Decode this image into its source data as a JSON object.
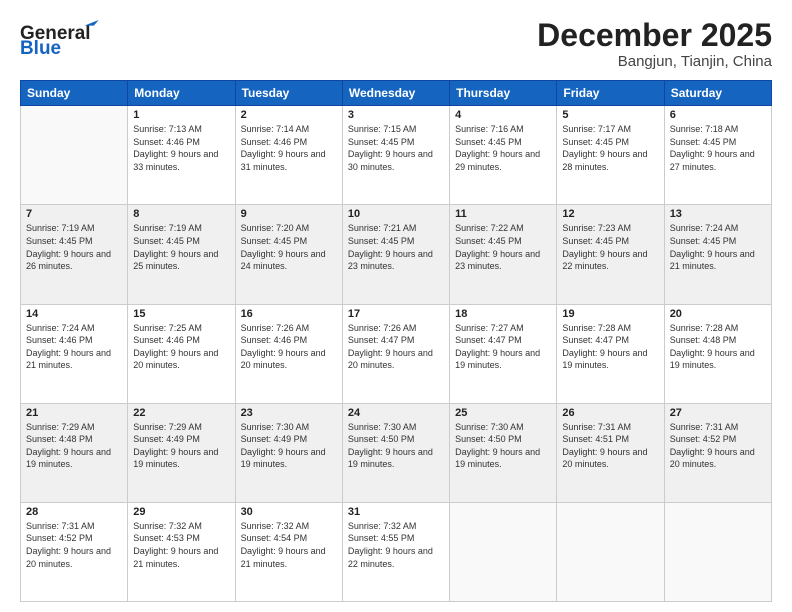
{
  "header": {
    "logo_general": "General",
    "logo_blue": "Blue",
    "month_title": "December 2025",
    "location": "Bangjun, Tianjin, China"
  },
  "days_of_week": [
    "Sunday",
    "Monday",
    "Tuesday",
    "Wednesday",
    "Thursday",
    "Friday",
    "Saturday"
  ],
  "weeks": [
    [
      {
        "day": "",
        "sunrise": "",
        "sunset": "",
        "daylight": ""
      },
      {
        "day": "1",
        "sunrise": "Sunrise: 7:13 AM",
        "sunset": "Sunset: 4:46 PM",
        "daylight": "Daylight: 9 hours and 33 minutes."
      },
      {
        "day": "2",
        "sunrise": "Sunrise: 7:14 AM",
        "sunset": "Sunset: 4:46 PM",
        "daylight": "Daylight: 9 hours and 31 minutes."
      },
      {
        "day": "3",
        "sunrise": "Sunrise: 7:15 AM",
        "sunset": "Sunset: 4:45 PM",
        "daylight": "Daylight: 9 hours and 30 minutes."
      },
      {
        "day": "4",
        "sunrise": "Sunrise: 7:16 AM",
        "sunset": "Sunset: 4:45 PM",
        "daylight": "Daylight: 9 hours and 29 minutes."
      },
      {
        "day": "5",
        "sunrise": "Sunrise: 7:17 AM",
        "sunset": "Sunset: 4:45 PM",
        "daylight": "Daylight: 9 hours and 28 minutes."
      },
      {
        "day": "6",
        "sunrise": "Sunrise: 7:18 AM",
        "sunset": "Sunset: 4:45 PM",
        "daylight": "Daylight: 9 hours and 27 minutes."
      }
    ],
    [
      {
        "day": "7",
        "sunrise": "Sunrise: 7:19 AM",
        "sunset": "Sunset: 4:45 PM",
        "daylight": "Daylight: 9 hours and 26 minutes."
      },
      {
        "day": "8",
        "sunrise": "Sunrise: 7:19 AM",
        "sunset": "Sunset: 4:45 PM",
        "daylight": "Daylight: 9 hours and 25 minutes."
      },
      {
        "day": "9",
        "sunrise": "Sunrise: 7:20 AM",
        "sunset": "Sunset: 4:45 PM",
        "daylight": "Daylight: 9 hours and 24 minutes."
      },
      {
        "day": "10",
        "sunrise": "Sunrise: 7:21 AM",
        "sunset": "Sunset: 4:45 PM",
        "daylight": "Daylight: 9 hours and 23 minutes."
      },
      {
        "day": "11",
        "sunrise": "Sunrise: 7:22 AM",
        "sunset": "Sunset: 4:45 PM",
        "daylight": "Daylight: 9 hours and 23 minutes."
      },
      {
        "day": "12",
        "sunrise": "Sunrise: 7:23 AM",
        "sunset": "Sunset: 4:45 PM",
        "daylight": "Daylight: 9 hours and 22 minutes."
      },
      {
        "day": "13",
        "sunrise": "Sunrise: 7:24 AM",
        "sunset": "Sunset: 4:45 PM",
        "daylight": "Daylight: 9 hours and 21 minutes."
      }
    ],
    [
      {
        "day": "14",
        "sunrise": "Sunrise: 7:24 AM",
        "sunset": "Sunset: 4:46 PM",
        "daylight": "Daylight: 9 hours and 21 minutes."
      },
      {
        "day": "15",
        "sunrise": "Sunrise: 7:25 AM",
        "sunset": "Sunset: 4:46 PM",
        "daylight": "Daylight: 9 hours and 20 minutes."
      },
      {
        "day": "16",
        "sunrise": "Sunrise: 7:26 AM",
        "sunset": "Sunset: 4:46 PM",
        "daylight": "Daylight: 9 hours and 20 minutes."
      },
      {
        "day": "17",
        "sunrise": "Sunrise: 7:26 AM",
        "sunset": "Sunset: 4:47 PM",
        "daylight": "Daylight: 9 hours and 20 minutes."
      },
      {
        "day": "18",
        "sunrise": "Sunrise: 7:27 AM",
        "sunset": "Sunset: 4:47 PM",
        "daylight": "Daylight: 9 hours and 19 minutes."
      },
      {
        "day": "19",
        "sunrise": "Sunrise: 7:28 AM",
        "sunset": "Sunset: 4:47 PM",
        "daylight": "Daylight: 9 hours and 19 minutes."
      },
      {
        "day": "20",
        "sunrise": "Sunrise: 7:28 AM",
        "sunset": "Sunset: 4:48 PM",
        "daylight": "Daylight: 9 hours and 19 minutes."
      }
    ],
    [
      {
        "day": "21",
        "sunrise": "Sunrise: 7:29 AM",
        "sunset": "Sunset: 4:48 PM",
        "daylight": "Daylight: 9 hours and 19 minutes."
      },
      {
        "day": "22",
        "sunrise": "Sunrise: 7:29 AM",
        "sunset": "Sunset: 4:49 PM",
        "daylight": "Daylight: 9 hours and 19 minutes."
      },
      {
        "day": "23",
        "sunrise": "Sunrise: 7:30 AM",
        "sunset": "Sunset: 4:49 PM",
        "daylight": "Daylight: 9 hours and 19 minutes."
      },
      {
        "day": "24",
        "sunrise": "Sunrise: 7:30 AM",
        "sunset": "Sunset: 4:50 PM",
        "daylight": "Daylight: 9 hours and 19 minutes."
      },
      {
        "day": "25",
        "sunrise": "Sunrise: 7:30 AM",
        "sunset": "Sunset: 4:50 PM",
        "daylight": "Daylight: 9 hours and 19 minutes."
      },
      {
        "day": "26",
        "sunrise": "Sunrise: 7:31 AM",
        "sunset": "Sunset: 4:51 PM",
        "daylight": "Daylight: 9 hours and 20 minutes."
      },
      {
        "day": "27",
        "sunrise": "Sunrise: 7:31 AM",
        "sunset": "Sunset: 4:52 PM",
        "daylight": "Daylight: 9 hours and 20 minutes."
      }
    ],
    [
      {
        "day": "28",
        "sunrise": "Sunrise: 7:31 AM",
        "sunset": "Sunset: 4:52 PM",
        "daylight": "Daylight: 9 hours and 20 minutes."
      },
      {
        "day": "29",
        "sunrise": "Sunrise: 7:32 AM",
        "sunset": "Sunset: 4:53 PM",
        "daylight": "Daylight: 9 hours and 21 minutes."
      },
      {
        "day": "30",
        "sunrise": "Sunrise: 7:32 AM",
        "sunset": "Sunset: 4:54 PM",
        "daylight": "Daylight: 9 hours and 21 minutes."
      },
      {
        "day": "31",
        "sunrise": "Sunrise: 7:32 AM",
        "sunset": "Sunset: 4:55 PM",
        "daylight": "Daylight: 9 hours and 22 minutes."
      },
      {
        "day": "",
        "sunrise": "",
        "sunset": "",
        "daylight": ""
      },
      {
        "day": "",
        "sunrise": "",
        "sunset": "",
        "daylight": ""
      },
      {
        "day": "",
        "sunrise": "",
        "sunset": "",
        "daylight": ""
      }
    ]
  ]
}
